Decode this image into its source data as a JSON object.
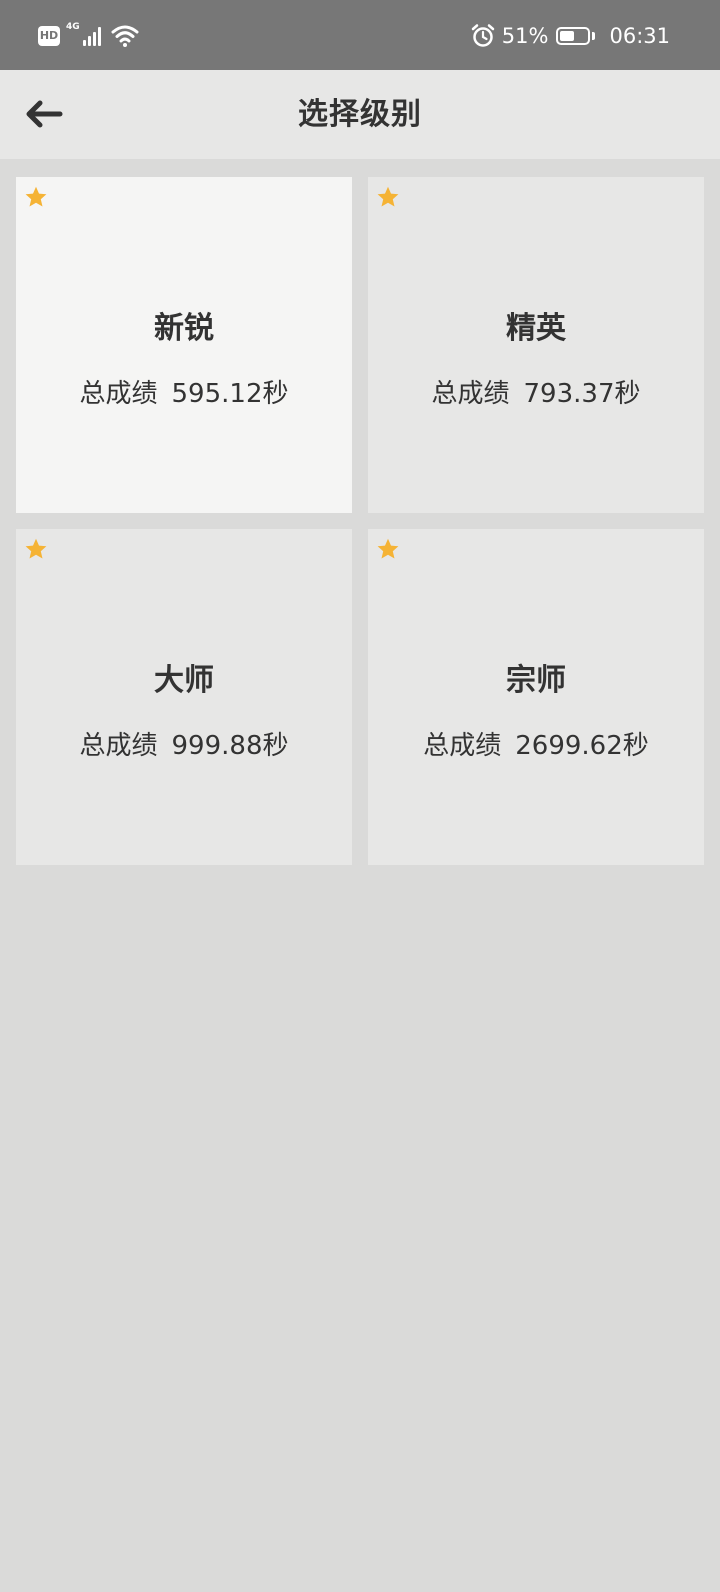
{
  "status_bar": {
    "hd_label": "HD",
    "network_label": "4G",
    "battery_percent": "51%",
    "battery_level": 0.51,
    "time": "06:31"
  },
  "app_bar": {
    "title": "选择级别",
    "back_icon": "arrow-left-icon"
  },
  "levels": [
    {
      "name": "新锐",
      "score_label": "总成绩",
      "score": "595.12秒",
      "starred": true,
      "selected": true
    },
    {
      "name": "精英",
      "score_label": "总成绩",
      "score": "793.37秒",
      "starred": true,
      "selected": false
    },
    {
      "name": "大师",
      "score_label": "总成绩",
      "score": "999.88秒",
      "starred": true,
      "selected": false
    },
    {
      "name": "宗师",
      "score_label": "总成绩",
      "score": "2699.62秒",
      "starred": true,
      "selected": false
    }
  ],
  "colors": {
    "star": "#F5B335",
    "text": "#333333",
    "status_bar": "#777777",
    "app_bar": "#E7E7E6",
    "card": "#E7E7E6",
    "card_selected": "#F5F5F4",
    "background": "#DADAD9"
  }
}
